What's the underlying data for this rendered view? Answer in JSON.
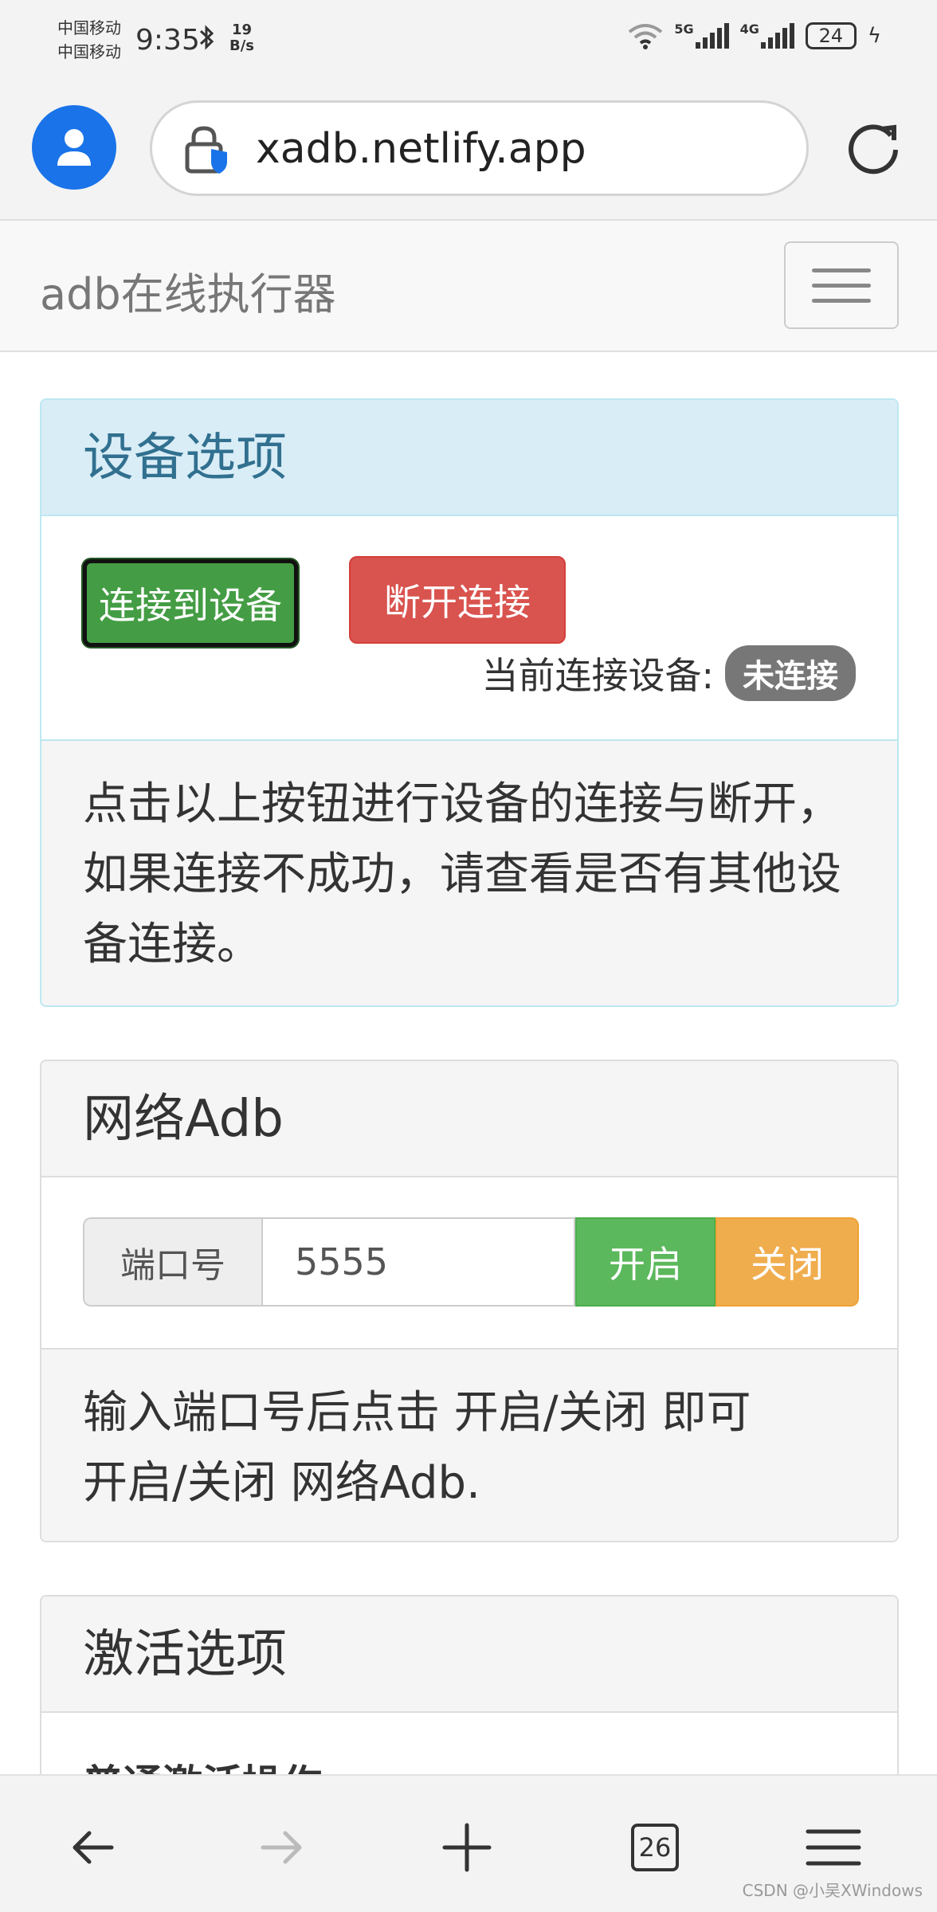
{
  "status_bar": {
    "carrier_1": "中国移动",
    "carrier_2": "中国移动",
    "time": "9:35",
    "net_speed_value": "19",
    "net_speed_unit": "B/s",
    "net_5g": "5G",
    "net_4g": "4G",
    "battery": "24"
  },
  "browser": {
    "url": "xadb.netlify.app",
    "tab_count": "26"
  },
  "navbar": {
    "brand": "adb在线执行器"
  },
  "device_panel": {
    "title": "设备选项",
    "connect_button": "连接到设备",
    "disconnect_button": "断开连接",
    "current_label": "当前连接设备:",
    "current_status": "未连接",
    "footer": "点击以上按钮进行设备的连接与断开，如果连接不成功，请查看是否有其他设备连接。"
  },
  "network_panel": {
    "title": "网络Adb",
    "port_label": "端口号",
    "port_value": "5555",
    "enable_button": "开启",
    "disable_button": "关闭",
    "footer_line1": "输入端口号后点击 开启/关闭 即可",
    "footer_line2": "开启/关闭 网络Adb."
  },
  "activate_panel": {
    "title": "激活选项",
    "subheading": "普通激活操作"
  },
  "watermark": "CSDN @小吴XWindows",
  "colors": {
    "brand_blue": "#1a73e8",
    "success": "#449d44",
    "danger": "#d9534f",
    "warning": "#f0ad4e",
    "info_header": "#d9edf7"
  }
}
